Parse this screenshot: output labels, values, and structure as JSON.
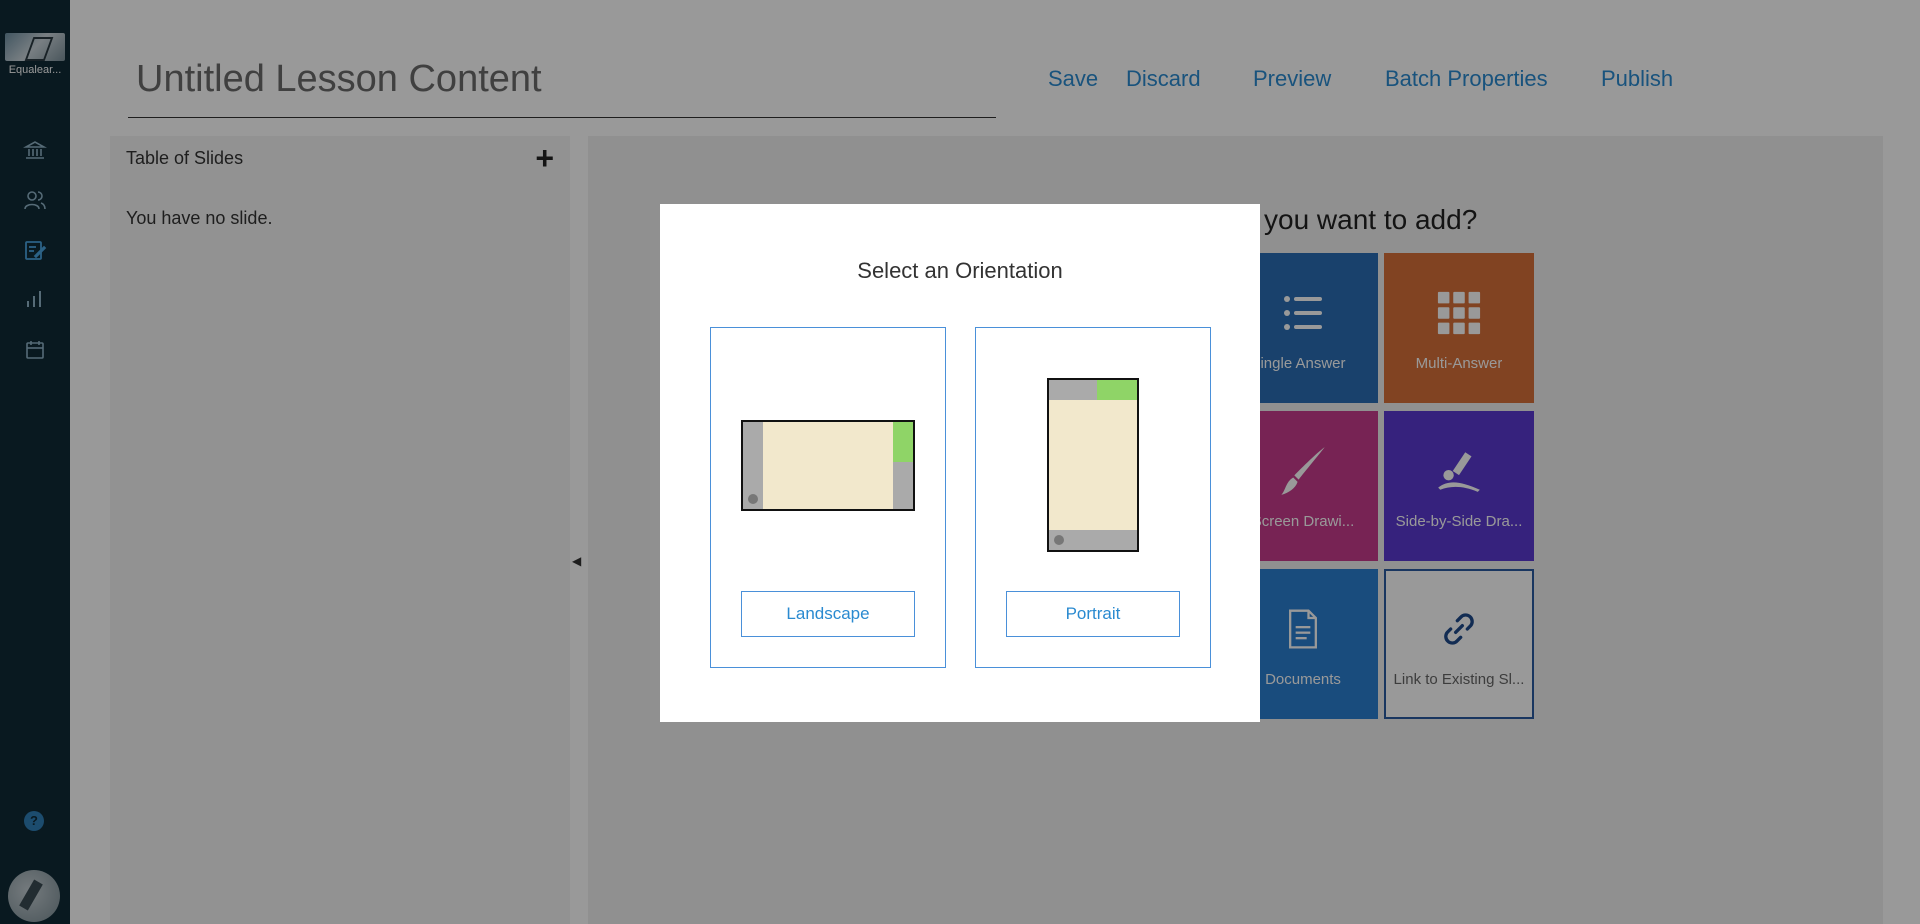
{
  "app": {
    "brand_name": "Equalear..."
  },
  "nav": {
    "items": [
      {
        "icon": "institution-icon"
      },
      {
        "icon": "users-icon"
      },
      {
        "icon": "lesson-edit-icon"
      },
      {
        "icon": "analytics-icon"
      },
      {
        "icon": "calendar-icon"
      }
    ],
    "help_label": "?"
  },
  "header": {
    "title": "Untitled Lesson Content"
  },
  "toolbar": {
    "save": "Save",
    "discard": "Discard",
    "preview": "Preview",
    "batch_properties": "Batch Properties",
    "publish": "Publish"
  },
  "slides_panel": {
    "heading": "Table of Slides",
    "add_label": "+",
    "empty_text": "You have no slide."
  },
  "collapse_arrow": "◀",
  "main": {
    "prompt_visible": "you want to add?",
    "tiles": [
      {
        "label": "ingle Answer",
        "color": "#2a6db5"
      },
      {
        "label": "Multi-Answer",
        "color": "#d8703a"
      },
      {
        "label": "Screen Drawi...",
        "color": "#c63b8c"
      },
      {
        "label": "Side-by-Side Dra...",
        "color": "#5a3ad1"
      },
      {
        "label": "Documents",
        "color": "#2a7fd0"
      },
      {
        "label": "Link to Existing Sl...",
        "color": "#ffffff"
      }
    ]
  },
  "modal": {
    "title": "Select an Orientation",
    "landscape_label": "Landscape",
    "portrait_label": "Portrait"
  },
  "colors": {
    "accent": "#2a8ad0",
    "nav_bg": "#0f2a36",
    "device_screen": "#f2e8cc",
    "device_green": "#8fd467"
  }
}
